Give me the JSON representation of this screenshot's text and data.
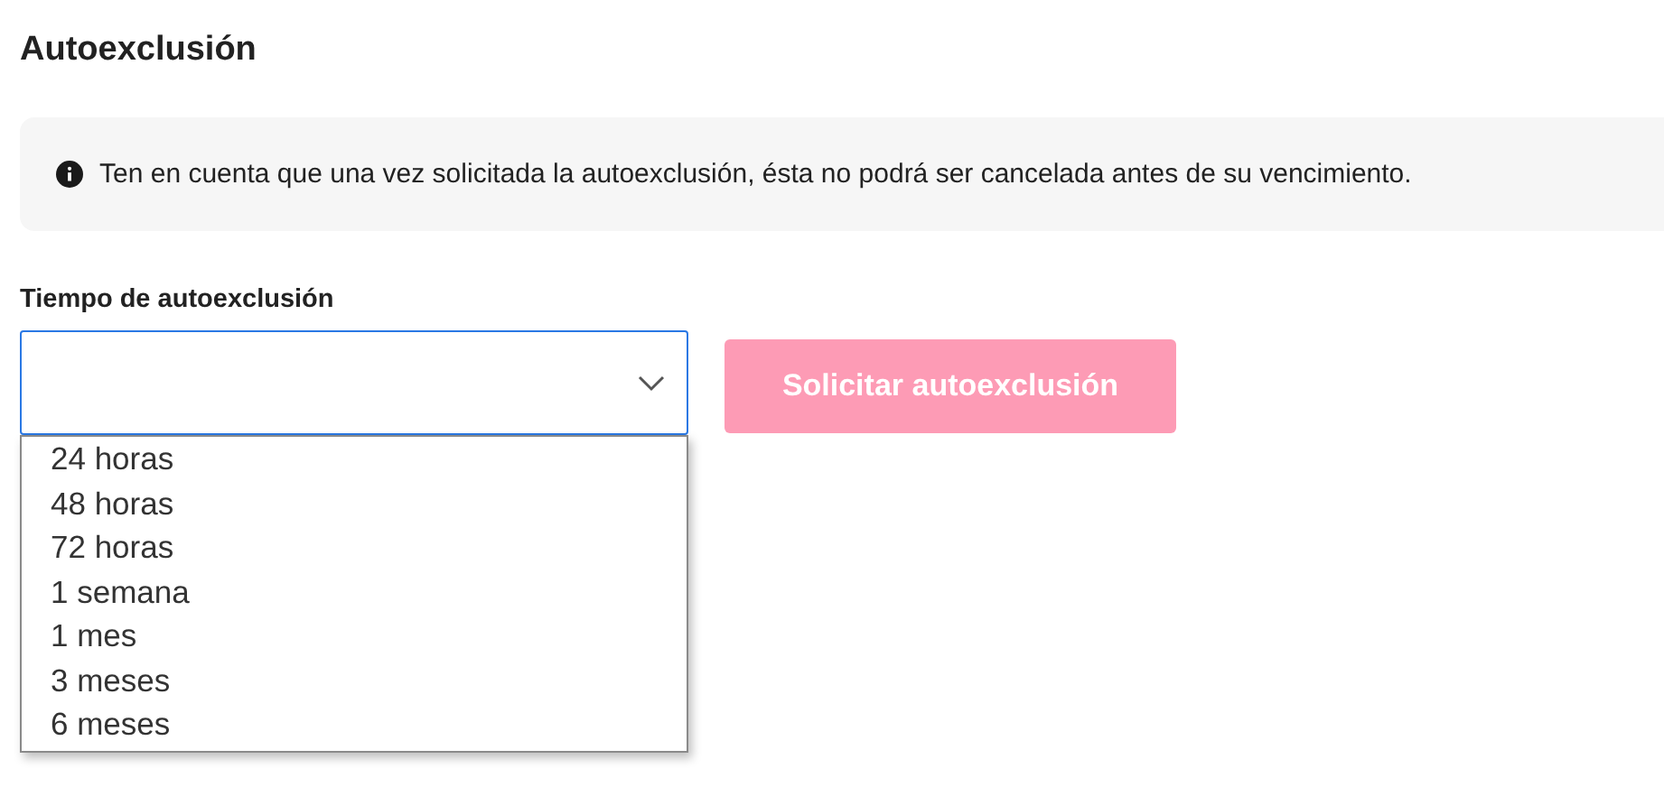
{
  "title": "Autoexclusión",
  "notice": {
    "text": "Ten en cuenta que una vez solicitada la autoexclusión, ésta no podrá ser cancelada antes de su vencimiento."
  },
  "duration_field": {
    "label": "Tiempo de autoexclusión",
    "expanded": true,
    "options": [
      {
        "label": "24 horas",
        "selected": false
      },
      {
        "label": "48 horas",
        "selected": false
      },
      {
        "label": "72 horas",
        "selected": false
      },
      {
        "label": "1 semana",
        "selected": false
      },
      {
        "label": "1 mes",
        "selected": false
      },
      {
        "label": "3 meses",
        "selected": false
      },
      {
        "label": "6 meses",
        "selected": false
      }
    ]
  },
  "submit_button": {
    "label": "Solicitar autoexclusión",
    "disabled": true
  }
}
